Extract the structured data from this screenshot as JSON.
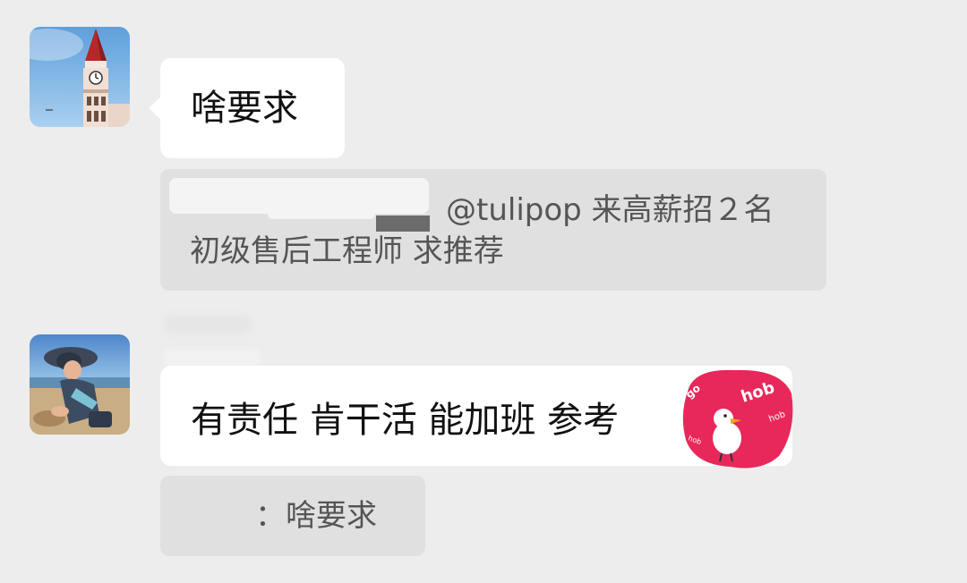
{
  "messages": [
    {
      "avatar": "clock-tower-avatar",
      "text": "啥要求"
    },
    {
      "quote_line1": "@tulipop 来高薪招２名",
      "quote_line2": "初级售后工程师 求推荐"
    },
    {
      "avatar": "child-on-beach-avatar",
      "text": "有责任 肯干活 能加班 参考",
      "sticker": "hobgoblin-duck-sticker"
    },
    {
      "quote_text": "：啥要求"
    }
  ],
  "colors": {
    "background": "#ededed",
    "bubble": "#ffffff",
    "quote": "#e0e0e0",
    "sticker": "#e8285a"
  }
}
